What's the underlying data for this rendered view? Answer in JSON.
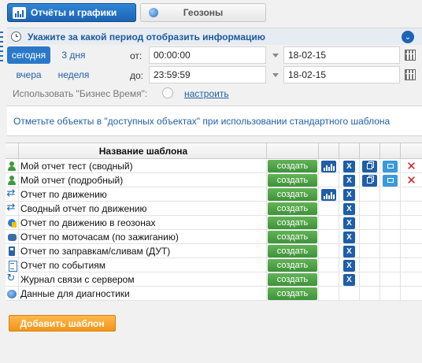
{
  "tabs": [
    {
      "label": "Отчёты и графики",
      "active": true,
      "icon": "chart-icon"
    },
    {
      "label": "Геозоны",
      "active": false,
      "icon": "globe-icon"
    }
  ],
  "period": {
    "title": "Укажите за какой период отобразить информацию",
    "buttons": [
      "сегодня",
      "3 дня",
      "вчера",
      "неделя"
    ],
    "active_button": "сегодня",
    "from_label": "от:",
    "to_label": "до:",
    "from_time": "00:00:00",
    "from_date": "18-02-15",
    "to_time": "23:59:59",
    "to_date": "18-02-15",
    "business_time_label": "Использовать \"Бизнес Время\":",
    "configure_link": "настроить"
  },
  "note": "Отметьте объекты в \"доступных объектах\" при использовании стандартного шаблона",
  "table": {
    "header": "Название шаблона",
    "create_label": "создать",
    "rows": [
      {
        "icon": "user-icon",
        "name": "Мой отчет тест (сводный)",
        "chart": true,
        "excel": true,
        "copy": true,
        "edit": true,
        "delete": true
      },
      {
        "icon": "user-icon",
        "name": "Мой отчет (подробный)",
        "chart": false,
        "excel": true,
        "copy": true,
        "edit": true,
        "delete": true
      },
      {
        "icon": "movement-icon",
        "name": "Отчет по движению",
        "chart": true,
        "excel": true,
        "copy": false,
        "edit": false,
        "delete": false
      },
      {
        "icon": "movement-icon",
        "name": "Сводный отчет по движению",
        "chart": false,
        "excel": true,
        "copy": false,
        "edit": false,
        "delete": false
      },
      {
        "icon": "geozone-icon",
        "name": "Отчет по движению в геозонах",
        "chart": false,
        "excel": true,
        "copy": false,
        "edit": false,
        "delete": false
      },
      {
        "icon": "engine-icon",
        "name": "Отчет по моточасам (по зажиганию)",
        "chart": false,
        "excel": true,
        "copy": false,
        "edit": false,
        "delete": false
      },
      {
        "icon": "fuel-icon",
        "name": "Отчет по заправкам/сливам (ДУТ)",
        "chart": false,
        "excel": true,
        "copy": false,
        "edit": false,
        "delete": false
      },
      {
        "icon": "events-icon",
        "name": "Отчет по событиям",
        "chart": false,
        "excel": true,
        "copy": false,
        "edit": false,
        "delete": false
      },
      {
        "icon": "refresh-icon",
        "name": "Журнал связи с сервером",
        "chart": false,
        "excel": true,
        "copy": false,
        "edit": false,
        "delete": false
      },
      {
        "icon": "diagnostics-icon",
        "name": "Данные для диагностики",
        "chart": false,
        "excel": false,
        "copy": false,
        "edit": false,
        "delete": false
      }
    ]
  },
  "add_template_label": "Добавить шаблон",
  "colors": {
    "accent": "#1c64b4",
    "create": "#4fa446",
    "add": "#f39418",
    "delete": "#d21b1b"
  }
}
